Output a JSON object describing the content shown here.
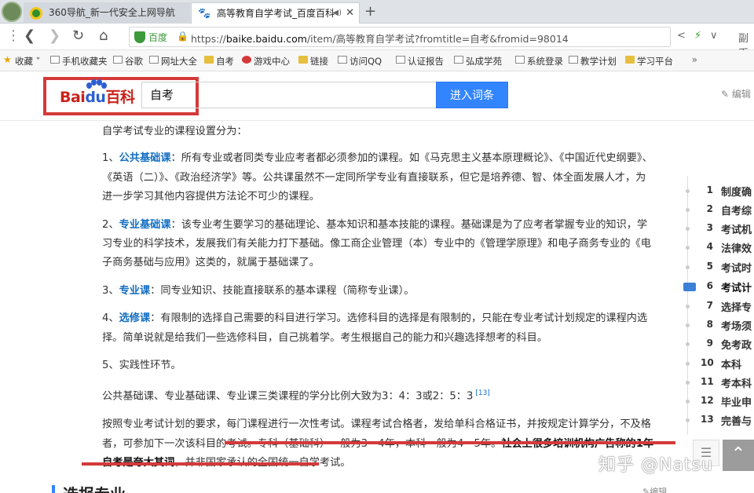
{
  "tabs": [
    {
      "title": "360导航_新一代安全上网导航"
    },
    {
      "title": "高等教育自学考试_百度百科"
    }
  ],
  "nav": {
    "site_label": "百度",
    "url_prefix": "https://",
    "url_host": "baike.baidu.com",
    "url_path": "/item/高等教育自学考试?fromtitle=自考&fromid=98014",
    "side_text": "副币"
  },
  "bookmarks": [
    "收藏",
    "手机收藏夹",
    "谷歌",
    "网址大全",
    "自考",
    "游戏中心",
    "链接",
    "访问QQ",
    "认证报告",
    "弘成学苑",
    "系统登录",
    "教学计划",
    "学习平台"
  ],
  "header": {
    "logo_bai": "Bai",
    "logo_du": "du",
    "logo_baike": "百科",
    "search_value": "自考",
    "search_button": "进入词条",
    "edit_label": "编辑"
  },
  "article": {
    "intro": "自学考试专业的课程设置分为：",
    "item1_prefix": "1、",
    "item1_link": "公共基础课",
    "item1_text": "：所有专业或者同类专业应考者都必须参加的课程。如《马克思主义基本原理概论》、《中国近代史纲要》、《英语（二）》、《政治经济学》等。公共课虽然不一定同所学专业有直接联系，但它是培养德、智、体全面发展人才，为进一步学习其他内容提供方法论不可少的课程。",
    "item2_prefix": "2、",
    "item2_link": "专业基础课",
    "item2_text": "：该专业考生要学习的基础理论、基本知识和基本技能的课程。基础课是为了应考者掌握专业的知识，学习专业的科学技术，发展我们有关能力打下基础。像工商企业管理（本）专业中的《管理学原理》和电子商务专业的《电子商务基础与应用》这类的，就属于基础课了。",
    "item3_prefix": "3、",
    "item3_link": "专业课",
    "item3_text": "：同专业知识、技能直接联系的基本课程（简称专业课）。",
    "item4_prefix": "4、",
    "item4_link": "选修课",
    "item4_text": "：有限制的选择自己需要的科目进行学习。选修科目的选择是有限制的，只能在专业考试计划规定的课程内选择。简单说就是给我们一些选修科目，自己挑着学。考生根据自己的能力和兴趣选择想考的科目。",
    "item5": "5、实践性环节。",
    "ratio": "公共基础课、专业基础课、专业课三类课程的学分比例大致为3：4：3或2：5：3",
    "ratio_ref": "[13]",
    "final_a": "按照专业考试计划的要求，每门课程进行一次性考试。课程考试合格者，发给单科合格证书，并按规定计算学分，不及格者，可参加下一次该科目的考试。专科（基础科）一般为3—4年，本科一般为4—5年。",
    "final_bold": "社会上很多培训机构广告称的1年自考是夸大其词",
    "final_c": "，并非国家承认的全国统一自学考试。",
    "next_section": "选报专业",
    "next_edit": "编辑"
  },
  "toc": [
    {
      "num": "1",
      "text": "制度确"
    },
    {
      "num": "2",
      "text": "自考综"
    },
    {
      "num": "3",
      "text": "考试机"
    },
    {
      "num": "4",
      "text": "法律效"
    },
    {
      "num": "5",
      "text": "考试时"
    },
    {
      "num": "6",
      "text": "考试计"
    },
    {
      "num": "7",
      "text": "选择专"
    },
    {
      "num": "8",
      "text": "考场须"
    },
    {
      "num": "9",
      "text": "免考政"
    },
    {
      "num": "10",
      "text": "本科"
    },
    {
      "num": "11",
      "text": "考本科"
    },
    {
      "num": "12",
      "text": "毕业申"
    },
    {
      "num": "13",
      "text": "完善与"
    }
  ],
  "watermark": "知乎 @Natsu",
  "colors": {
    "accent": "#3385ff",
    "highlight_red": "#d43a3a",
    "link": "#136ec2"
  }
}
